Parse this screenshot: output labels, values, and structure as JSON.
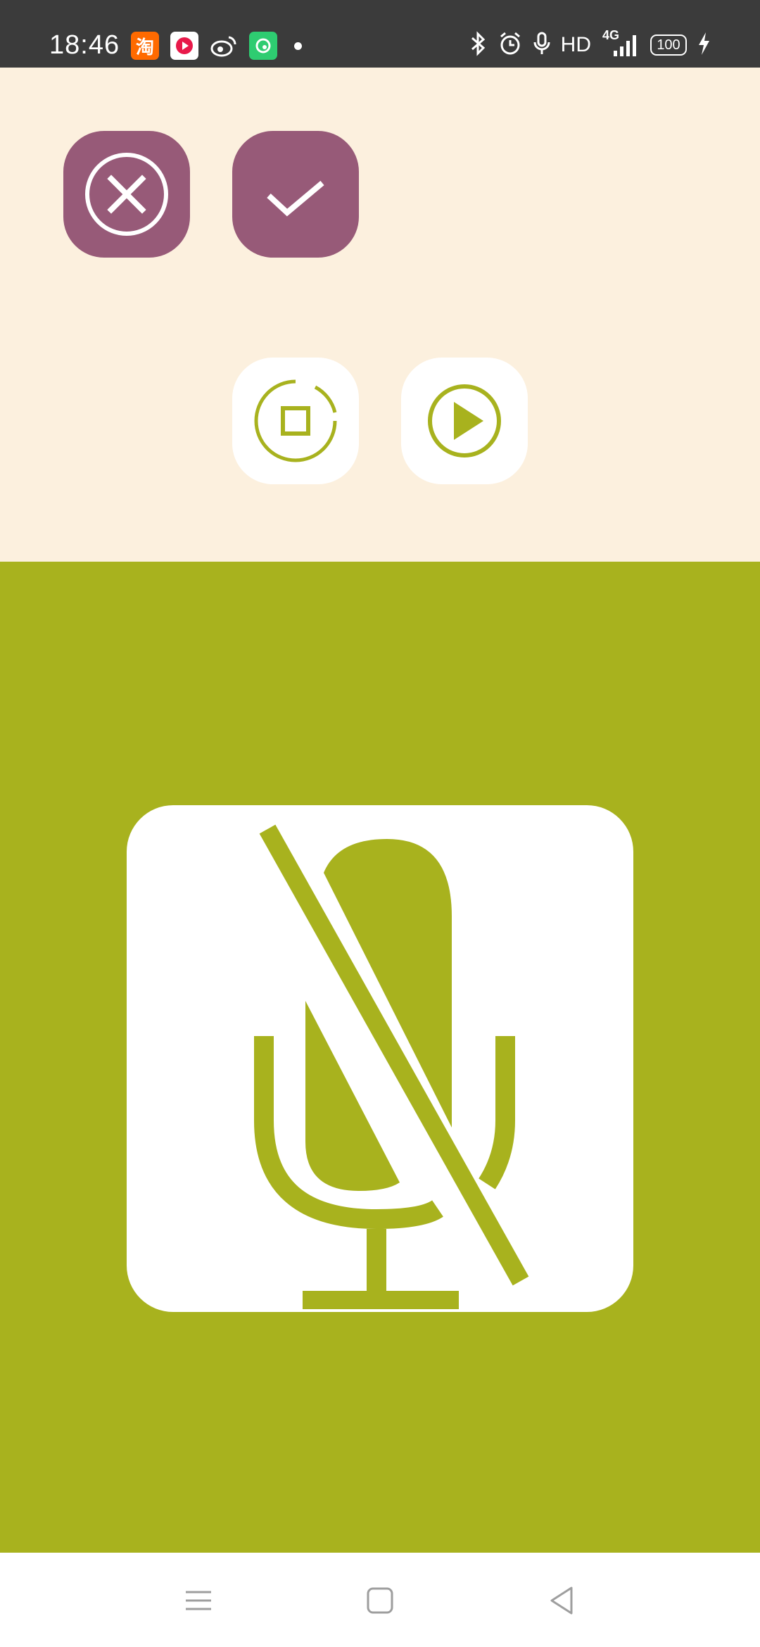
{
  "status_bar": {
    "time": "18:46",
    "network": "HD",
    "network_type": "4G",
    "battery": "100",
    "left_icons": [
      "taobao-icon",
      "video-app-icon",
      "weibo-icon",
      "green-app-icon",
      "notification-dot-icon"
    ],
    "right_icons": [
      "bluetooth-icon",
      "alarm-icon",
      "mic-icon",
      "signal-icon",
      "battery-icon",
      "charging-icon"
    ],
    "taobao_glyph": "淘"
  },
  "controls": {
    "cancel": {
      "icon": "close-circle-icon"
    },
    "confirm": {
      "icon": "checkmark-icon"
    },
    "stop": {
      "icon": "stop-record-icon"
    },
    "play": {
      "icon": "play-circle-icon"
    }
  },
  "mic": {
    "icon": "mic-muted-icon",
    "state": "muted"
  },
  "nav_bar": {
    "icons": [
      "menu-icon",
      "home-icon",
      "back-icon"
    ]
  },
  "colors": {
    "status_bar": "#3b3b3b",
    "top_panel": "#fcf0de",
    "purple_button": "#975a78",
    "accent_olive": "#a8b21e",
    "white": "#ffffff"
  }
}
